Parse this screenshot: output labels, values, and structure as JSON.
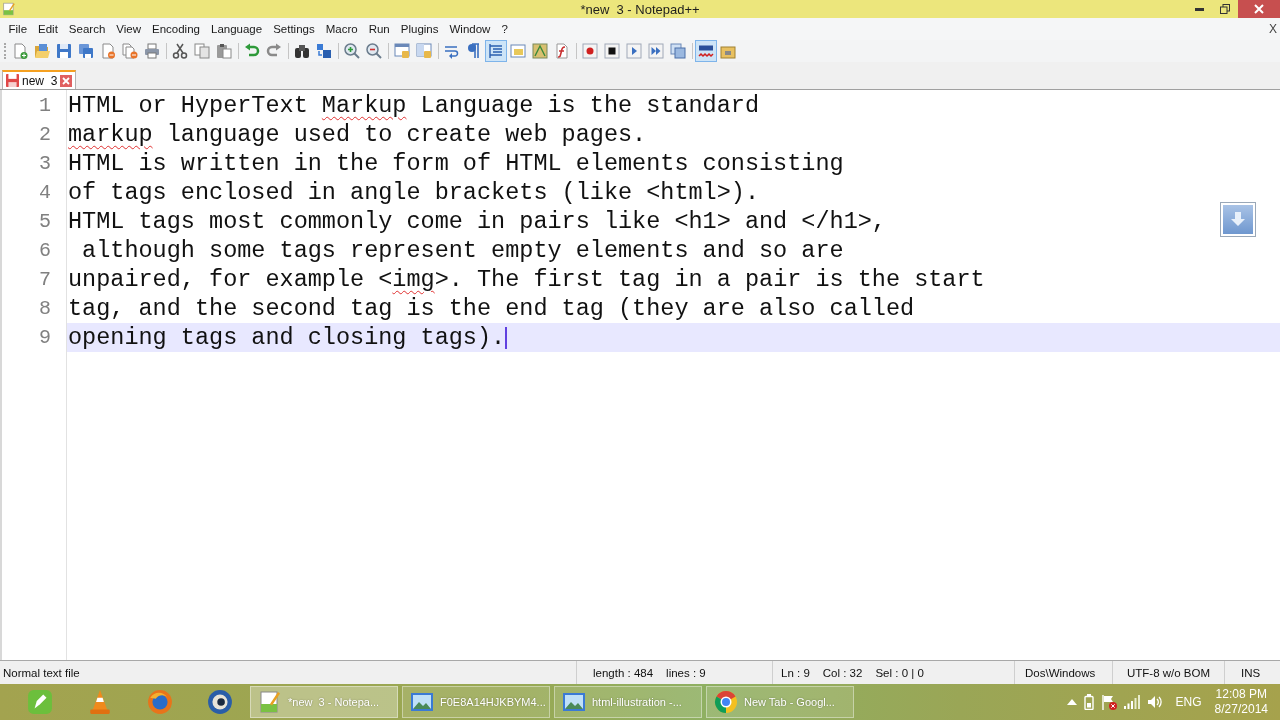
{
  "window": {
    "title": "*new  3 - Notepad++"
  },
  "menu": {
    "items": [
      "File",
      "Edit",
      "Search",
      "View",
      "Encoding",
      "Language",
      "Settings",
      "Macro",
      "Run",
      "Plugins",
      "Window",
      "?"
    ],
    "close": "X"
  },
  "toolbar": [
    {
      "kind": "new",
      "pressed": false
    },
    {
      "kind": "open",
      "pressed": false
    },
    {
      "kind": "save",
      "pressed": false
    },
    {
      "kind": "saveall",
      "pressed": false
    },
    {
      "kind": "close",
      "pressed": false
    },
    {
      "kind": "closeall",
      "pressed": false
    },
    {
      "kind": "print",
      "pressed": false
    },
    {
      "kind": "separator"
    },
    {
      "kind": "cut",
      "pressed": false
    },
    {
      "kind": "copy",
      "pressed": false
    },
    {
      "kind": "paste",
      "pressed": false
    },
    {
      "kind": "separator"
    },
    {
      "kind": "undo",
      "pressed": false
    },
    {
      "kind": "redo",
      "pressed": false
    },
    {
      "kind": "separator"
    },
    {
      "kind": "find",
      "pressed": false
    },
    {
      "kind": "replace",
      "pressed": false
    },
    {
      "kind": "separator"
    },
    {
      "kind": "zoomin",
      "pressed": false
    },
    {
      "kind": "zoomout",
      "pressed": false
    },
    {
      "kind": "separator"
    },
    {
      "kind": "syncv",
      "pressed": false
    },
    {
      "kind": "synch",
      "pressed": false
    },
    {
      "kind": "separator"
    },
    {
      "kind": "wrap",
      "pressed": false
    },
    {
      "kind": "allchars",
      "pressed": false
    },
    {
      "kind": "indent",
      "pressed": true
    },
    {
      "kind": "userlang",
      "pressed": false
    },
    {
      "kind": "docmap",
      "pressed": false
    },
    {
      "kind": "funclist",
      "pressed": false
    },
    {
      "kind": "separator"
    },
    {
      "kind": "record",
      "pressed": false
    },
    {
      "kind": "stop",
      "pressed": false
    },
    {
      "kind": "play",
      "pressed": false
    },
    {
      "kind": "playmulti",
      "pressed": false
    },
    {
      "kind": "savemacro",
      "pressed": false
    },
    {
      "kind": "separator"
    },
    {
      "kind": "spell",
      "pressed": true
    },
    {
      "kind": "plugin",
      "pressed": false
    }
  ],
  "tabs": [
    {
      "label": "new  3",
      "selected": true,
      "modified": true
    }
  ],
  "editor": {
    "lines": [
      {
        "number": "1",
        "current": false,
        "segments": [
          {
            "text": "HTML or HyperText ",
            "misspelled": false
          },
          {
            "text": "Markup",
            "misspelled": true
          },
          {
            "text": " Language is the standard",
            "misspelled": false
          }
        ]
      },
      {
        "number": "2",
        "current": false,
        "segments": [
          {
            "text": "markup",
            "misspelled": true
          },
          {
            "text": " language used to create web pages.",
            "misspelled": false
          }
        ]
      },
      {
        "number": "3",
        "current": false,
        "segments": [
          {
            "text": "HTML is written in the form of HTML elements consisting",
            "misspelled": false
          }
        ]
      },
      {
        "number": "4",
        "current": false,
        "segments": [
          {
            "text": "of tags enclosed in angle brackets (like <html>).",
            "misspelled": false
          }
        ]
      },
      {
        "number": "5",
        "current": false,
        "segments": [
          {
            "text": "HTML tags most commonly come in pairs like <h1> and </h1>,",
            "misspelled": false
          }
        ]
      },
      {
        "number": "6",
        "current": false,
        "segments": [
          {
            "text": " although some tags represent empty elements and so are",
            "misspelled": false
          }
        ]
      },
      {
        "number": "7",
        "current": false,
        "segments": [
          {
            "text": "unpaired, for example <",
            "misspelled": false
          },
          {
            "text": "img",
            "misspelled": true
          },
          {
            "text": ">. The first tag in a pair is the start",
            "misspelled": false
          }
        ]
      },
      {
        "number": "8",
        "current": false,
        "segments": [
          {
            "text": "tag, and the second tag is the end tag (they are also called",
            "misspelled": false
          }
        ]
      },
      {
        "number": "9",
        "current": true,
        "segments": [
          {
            "text": "opening tags and closing tags).",
            "misspelled": false
          }
        ]
      }
    ]
  },
  "status_bar": {
    "file_type": "Normal text file",
    "length": "length : 484",
    "lines": "lines : 9",
    "ln": "Ln : 9",
    "col": "Col : 32",
    "sel": "Sel : 0 | 0",
    "eol": "Dos\\Windows",
    "encoding": "UTF-8 w/o BOM",
    "mode": "INS"
  },
  "taskbar": {
    "pinned": [
      {
        "kind": "pen"
      },
      {
        "kind": "cone"
      },
      {
        "kind": "globe"
      },
      {
        "kind": "lens"
      }
    ],
    "tasks": [
      {
        "kind": "notepad",
        "label": "*new  3 - Notepa...",
        "active": true
      },
      {
        "kind": "picture",
        "label": "F0E8A14HJKBYM4...",
        "active": false
      },
      {
        "kind": "picture",
        "label": "html-illustration -...",
        "active": false
      },
      {
        "kind": "browser",
        "label": "New Tab - Googl...",
        "active": false
      }
    ],
    "tray": {
      "language": "ENG",
      "time": "12:08 PM",
      "date": "8/27/2014"
    }
  }
}
